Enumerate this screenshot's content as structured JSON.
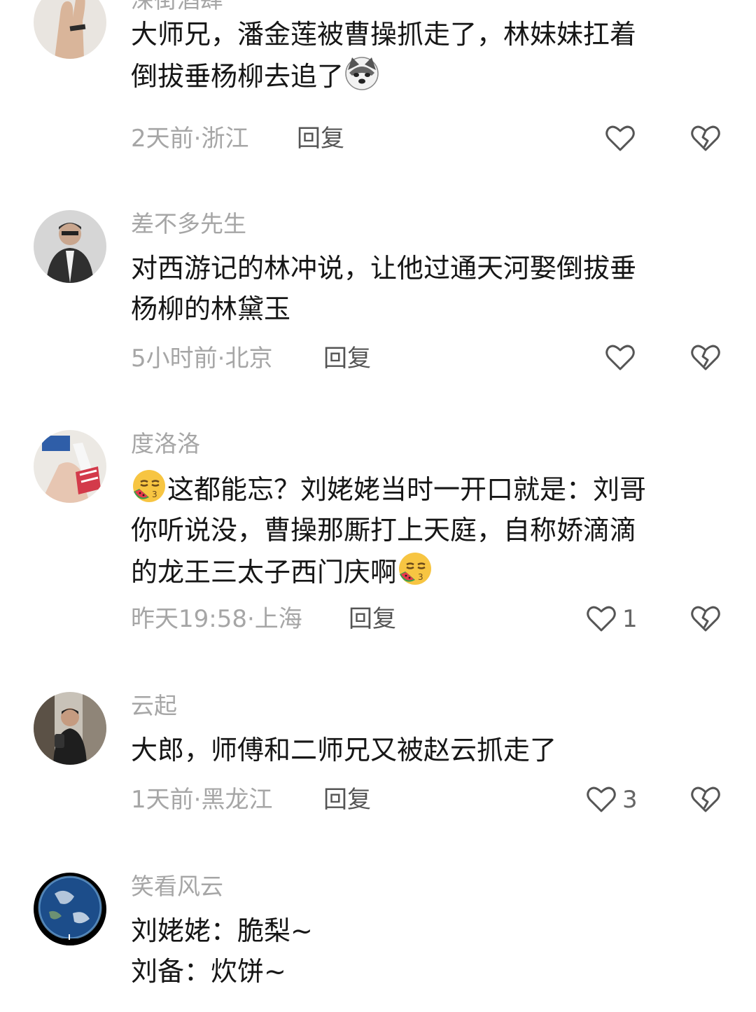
{
  "comments": [
    {
      "username": "深街酒肆",
      "lines": [
        "大师兄，潘金莲被曹操抓走了，林妹妹扛着",
        "倒拔垂杨柳去追了"
      ],
      "time_location": "2天前·浙江",
      "reply_label": "回复",
      "like_count": ""
    },
    {
      "username": "差不多先生",
      "lines": [
        "对西游记的林冲说，让他过通天河娶倒拔垂",
        "杨柳的林黛玉"
      ],
      "time_location": "5小时前·北京",
      "reply_label": "回复",
      "like_count": ""
    },
    {
      "username": "度洛洛",
      "lines": [
        "这都能忘？刘姥姥当时一开口就是：刘哥",
        "你听说没，曹操那厮打上天庭，自称娇滴滴",
        "的龙王三太子西门庆啊"
      ],
      "time_location": "昨天19:58·上海",
      "reply_label": "回复",
      "like_count": "1"
    },
    {
      "username": "云起",
      "lines": [
        "大郎，师傅和二师兄又被赵云抓走了"
      ],
      "time_location": "1天前·黑龙江",
      "reply_label": "回复",
      "like_count": "3"
    },
    {
      "username": "笑看风云",
      "lines": [
        "刘姥姥：脆梨~",
        "刘备：炊饼~"
      ],
      "time_location": "",
      "reply_label": "",
      "like_count": ""
    }
  ],
  "icons": {
    "like": "heart-outline-icon",
    "dislike": "broken-heart-icon",
    "emoji_dog": "dog-face-emoji-icon",
    "emoji_face": "eating-watermelon-emoji-icon"
  }
}
